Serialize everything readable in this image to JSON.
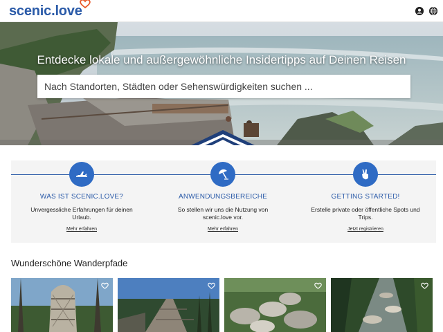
{
  "header": {
    "logo_part1": "scenic.",
    "logo_part2": "love",
    "icons": [
      "account-circle-icon",
      "globe-icon"
    ]
  },
  "hero": {
    "title": "Entdecke lokale und außergewöhnliche Insidertipps auf Deinen Reisen",
    "search_placeholder": "Nach Standorten, Städten oder Sehenswürdigkeiten suchen ..."
  },
  "info": [
    {
      "icon": "airplane-icon",
      "title": "WAS IST SCENIC.LOVE?",
      "text": "Unvergessliche Erfahrungen für deinen Urlaub.",
      "link": "Mehr erfahren"
    },
    {
      "icon": "beach-umbrella-icon",
      "title": "ANWENDUNGSBEREICHE",
      "text": "So stellen wir uns die Nutzung von scenic.love vor.",
      "link": "Mehr erfahren"
    },
    {
      "icon": "hand-peace-icon",
      "title": "GETTING STARTED!",
      "text": "Erstelle private oder öffentliche Spots und Trips.",
      "link": "Jetzt registrieren"
    }
  ],
  "section": {
    "title": "Wunderschöne Wanderpfade"
  },
  "colors": {
    "brand": "#2a5aa8",
    "accent_orange": "#e8582a",
    "icon_circle": "#2f6bc4",
    "band_bg": "#f4f4f4"
  }
}
